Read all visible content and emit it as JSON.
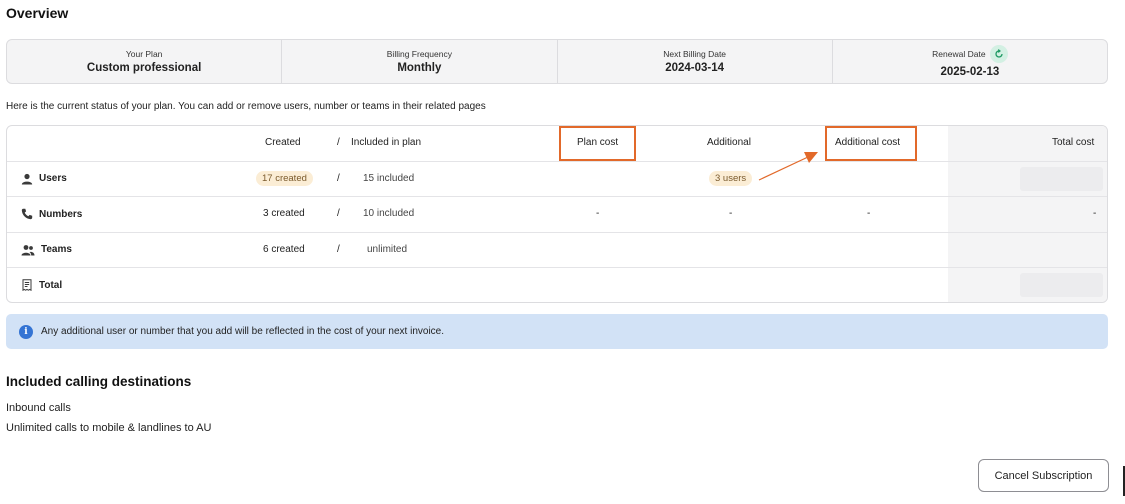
{
  "page": {
    "title": "Overview"
  },
  "summary": {
    "plan_label": "Your Plan",
    "plan_value": "Custom professional",
    "frequency_label": "Billing Frequency",
    "frequency_value": "Monthly",
    "next_billing_label": "Next Billing Date",
    "next_billing_value": "2024-03-14",
    "renewal_label": "Renewal Date",
    "renewal_value": "2025-02-13",
    "renewal_icon": "refresh-icon"
  },
  "intro_text": "Here is the current status of your plan. You can add or remove users, number or teams in their related pages",
  "table": {
    "headers": {
      "created": "Created",
      "separator": "/",
      "included": "Included in plan",
      "plan_cost": "Plan cost",
      "additional": "Additional",
      "additional_cost": "Additional cost",
      "total_cost": "Total cost"
    },
    "rows": {
      "users": {
        "name": "Users",
        "icon": "user-icon",
        "created": "17 created",
        "separator": "/",
        "included": "15 included",
        "additional": "3 users"
      },
      "numbers": {
        "name": "Numbers",
        "icon": "phone-icon",
        "created": "3 created",
        "separator": "/",
        "included": "10 included",
        "plan_cost": "-",
        "additional": "-",
        "additional_cost": "-",
        "total_cost": "-"
      },
      "teams": {
        "name": "Teams",
        "icon": "team-icon",
        "created": "6 created",
        "separator": "/",
        "included": "unlimited"
      },
      "total": {
        "name": "Total",
        "icon": "receipt-icon"
      }
    },
    "highlight_color": "#e2692a"
  },
  "notice": {
    "icon": "info-icon",
    "glyph": "i",
    "text": "Any additional user or number that you add will be reflected in the cost of your next invoice."
  },
  "destinations": {
    "title": "Included calling destinations",
    "items": [
      "Inbound calls",
      "Unlimited calls to mobile & landlines to AU"
    ]
  },
  "actions": {
    "cancel_label": "Cancel Subscription"
  }
}
